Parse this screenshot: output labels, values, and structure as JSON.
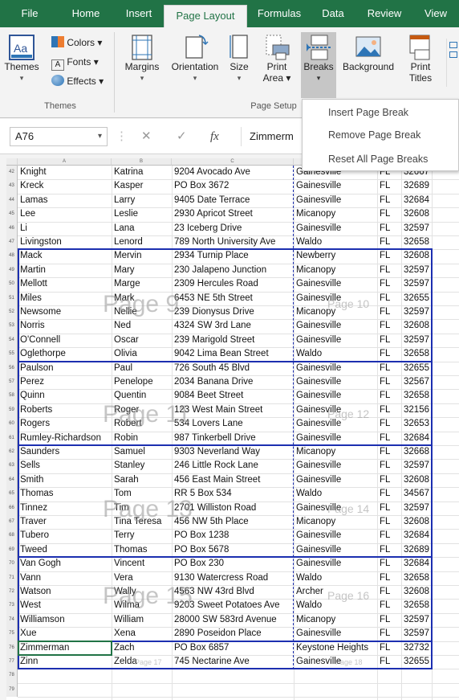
{
  "tabs": [
    {
      "label": "File",
      "active": false
    },
    {
      "label": "Home",
      "active": false
    },
    {
      "label": "Insert",
      "active": false
    },
    {
      "label": "Page Layout",
      "active": true
    },
    {
      "label": "Formulas",
      "active": false
    },
    {
      "label": "Data",
      "active": false
    },
    {
      "label": "Review",
      "active": false
    },
    {
      "label": "View",
      "active": false
    }
  ],
  "ribbon": {
    "themes_group": {
      "themes_label": "Themes",
      "colors_label": "Colors",
      "fonts_label": "Fonts",
      "effects_label": "Effects",
      "group_label": "Themes"
    },
    "page_setup_group": {
      "margins_label": "Margins",
      "orientation_label": "Orientation",
      "size_label": "Size",
      "print_area_label_1": "Print",
      "print_area_label_2": "Area",
      "breaks_label": "Breaks",
      "background_label": "Background",
      "print_titles_label_1": "Print",
      "print_titles_label_2": "Titles",
      "group_label": "Page Setup"
    },
    "breaks_menu": [
      "Insert Page Break",
      "Remove Page Break",
      "Reset All Page Breaks"
    ]
  },
  "formula_bar": {
    "name_box": "A76",
    "cancel_icon": "✕",
    "enter_icon": "✓",
    "fx_label": "fx",
    "content": "Zimmerm"
  },
  "column_headers": [
    "A",
    "B",
    "C",
    "D",
    "E",
    "F"
  ],
  "rows": [
    {
      "n": "42",
      "last": "Knight",
      "first": "Katrina",
      "address": "9204 Avocado Ave",
      "city": "Gainesville",
      "state": "FL",
      "zip": "32667"
    },
    {
      "n": "43",
      "last": "Kreck",
      "first": "Kasper",
      "address": "PO Box 3672",
      "city": "Gainesville",
      "state": "FL",
      "zip": "32689"
    },
    {
      "n": "44",
      "last": "Lamas",
      "first": "Larry",
      "address": "9405 Date Terrace",
      "city": "Gainesville",
      "state": "FL",
      "zip": "32684"
    },
    {
      "n": "45",
      "last": "Lee",
      "first": "Leslie",
      "address": "2930 Apricot Street",
      "city": "Micanopy",
      "state": "FL",
      "zip": "32608"
    },
    {
      "n": "46",
      "last": "Li",
      "first": "Lana",
      "address": "23 Iceberg Drive",
      "city": "Gainesville",
      "state": "FL",
      "zip": "32597"
    },
    {
      "n": "47",
      "last": "Livingston",
      "first": "Lenord",
      "address": "789 North University Ave",
      "city": "Waldo",
      "state": "FL",
      "zip": "32658"
    },
    {
      "n": "48",
      "last": "Mack",
      "first": "Mervin",
      "address": "2934 Turnip Place",
      "city": "Newberry",
      "state": "FL",
      "zip": "32608"
    },
    {
      "n": "49",
      "last": "Martin",
      "first": "Mary",
      "address": "230 Jalapeno Junction",
      "city": "Micanopy",
      "state": "FL",
      "zip": "32597"
    },
    {
      "n": "50",
      "last": "Mellott",
      "first": "Marge",
      "address": "2309 Hercules Road",
      "city": "Gainesville",
      "state": "FL",
      "zip": "32597"
    },
    {
      "n": "51",
      "last": "Miles",
      "first": "Mark",
      "address": "6453 NE 5th Street",
      "city": "Gainesville",
      "state": "FL",
      "zip": "32655"
    },
    {
      "n": "52",
      "last": "Newsome",
      "first": "Nellie",
      "address": "239 Dionysus Drive",
      "city": "Micanopy",
      "state": "FL",
      "zip": "32597"
    },
    {
      "n": "53",
      "last": "Norris",
      "first": "Ned",
      "address": "4324 SW 3rd Lane",
      "city": "Gainesville",
      "state": "FL",
      "zip": "32608"
    },
    {
      "n": "54",
      "last": "O'Connell",
      "first": "Oscar",
      "address": "239 Marigold Street",
      "city": "Gainesville",
      "state": "FL",
      "zip": "32597"
    },
    {
      "n": "55",
      "last": "Oglethorpe",
      "first": "Olivia",
      "address": "9042 Lima Bean Street",
      "city": "Waldo",
      "state": "FL",
      "zip": "32658"
    },
    {
      "n": "56",
      "last": "Paulson",
      "first": "Paul",
      "address": "726 South 45 Blvd",
      "city": "Gainesville",
      "state": "FL",
      "zip": "32655"
    },
    {
      "n": "57",
      "last": "Perez",
      "first": "Penelope",
      "address": "2034 Banana Drive",
      "city": "Gainesville",
      "state": "FL",
      "zip": "32567"
    },
    {
      "n": "58",
      "last": "Quinn",
      "first": "Quentin",
      "address": "9084 Beet Street",
      "city": "Gainesville",
      "state": "FL",
      "zip": "32658"
    },
    {
      "n": "59",
      "last": "Roberts",
      "first": "Roger",
      "address": "123 West Main Street",
      "city": "Gainesville",
      "state": "FL",
      "zip": "32156"
    },
    {
      "n": "60",
      "last": "Rogers",
      "first": "Robert",
      "address": "534 Lovers Lane",
      "city": "Gainesville",
      "state": "FL",
      "zip": "32653"
    },
    {
      "n": "61",
      "last": "Rumley-Richardson",
      "first": "Robin",
      "address": "987 Tinkerbell Drive",
      "city": "Gainesville",
      "state": "FL",
      "zip": "32684"
    },
    {
      "n": "62",
      "last": "Saunders",
      "first": "Samuel",
      "address": "9303 Neverland Way",
      "city": "Micanopy",
      "state": "FL",
      "zip": "32668"
    },
    {
      "n": "63",
      "last": "Sells",
      "first": "Stanley",
      "address": "246 Little Rock Lane",
      "city": "Gainesville",
      "state": "FL",
      "zip": "32597"
    },
    {
      "n": "64",
      "last": "Smith",
      "first": "Sarah",
      "address": "456 East Main Street",
      "city": "Gainesville",
      "state": "FL",
      "zip": "32608"
    },
    {
      "n": "65",
      "last": "Thomas",
      "first": "Tom",
      "address": "RR 5 Box 534",
      "city": "Waldo",
      "state": "FL",
      "zip": "34567"
    },
    {
      "n": "66",
      "last": "Tinnez",
      "first": "Tim",
      "address": "2701 Williston Road",
      "city": "Gainesville",
      "state": "FL",
      "zip": "32597"
    },
    {
      "n": "67",
      "last": "Traver",
      "first": "Tina Teresa",
      "address": "456 NW 5th Place",
      "city": "Micanopy",
      "state": "FL",
      "zip": "32608"
    },
    {
      "n": "68",
      "last": "Tubero",
      "first": "Terry",
      "address": "PO Box 1238",
      "city": "Gainesville",
      "state": "FL",
      "zip": "32684"
    },
    {
      "n": "69",
      "last": "Tweed",
      "first": "Thomas",
      "address": "PO Box 5678",
      "city": "Gainesville",
      "state": "FL",
      "zip": "32689"
    },
    {
      "n": "70",
      "last": "Van Gogh",
      "first": "Vincent",
      "address": "PO Box 230",
      "city": "Gainesville",
      "state": "FL",
      "zip": "32684"
    },
    {
      "n": "71",
      "last": "Vann",
      "first": "Vera",
      "address": "9130 Watercress Road",
      "city": "Waldo",
      "state": "FL",
      "zip": "32658"
    },
    {
      "n": "72",
      "last": "Watson",
      "first": "Wally",
      "address": "4563 NW 43rd Blvd",
      "city": "Archer",
      "state": "FL",
      "zip": "32608"
    },
    {
      "n": "73",
      "last": "West",
      "first": "Wilma",
      "address": "9203 Sweet Potatoes Ave",
      "city": "Waldo",
      "state": "FL",
      "zip": "32658"
    },
    {
      "n": "74",
      "last": "Williamson",
      "first": "William",
      "address": "28000 SW 583rd Avenue",
      "city": "Micanopy",
      "state": "FL",
      "zip": "32597"
    },
    {
      "n": "75",
      "last": "Xue",
      "first": "Xena",
      "address": "2890 Poseidon Place",
      "city": "Gainesville",
      "state": "FL",
      "zip": "32597"
    },
    {
      "n": "76",
      "last": "Zimmerman",
      "first": "Zach",
      "address": "PO Box 6857",
      "city": "Keystone Heights",
      "state": "FL",
      "zip": "32732"
    },
    {
      "n": "77",
      "last": "Zinn",
      "first": "Zelda",
      "address": "745 Nectarine Ave",
      "city": "Gainesville",
      "state": "FL",
      "zip": "32655"
    },
    {
      "n": "78",
      "last": "",
      "first": "",
      "address": "",
      "city": "",
      "state": "",
      "zip": ""
    },
    {
      "n": "79",
      "last": "",
      "first": "",
      "address": "",
      "city": "",
      "state": "",
      "zip": ""
    }
  ],
  "page_watermarks": [
    {
      "text": "Page 9",
      "size": "big"
    },
    {
      "text": "Page 10",
      "size": "small"
    },
    {
      "text": "Page 11",
      "size": "big"
    },
    {
      "text": "Page 12",
      "size": "small"
    },
    {
      "text": "Page 13",
      "size": "big"
    },
    {
      "text": "Page 14",
      "size": "small"
    },
    {
      "text": "Page 15",
      "size": "big"
    },
    {
      "text": "Page 16",
      "size": "small"
    },
    {
      "text": "Page 17",
      "size": "tiny"
    },
    {
      "text": "Page 18",
      "size": "tiny"
    }
  ],
  "colors": {
    "accent": "#217346",
    "page_break": "#1c2fb0"
  }
}
